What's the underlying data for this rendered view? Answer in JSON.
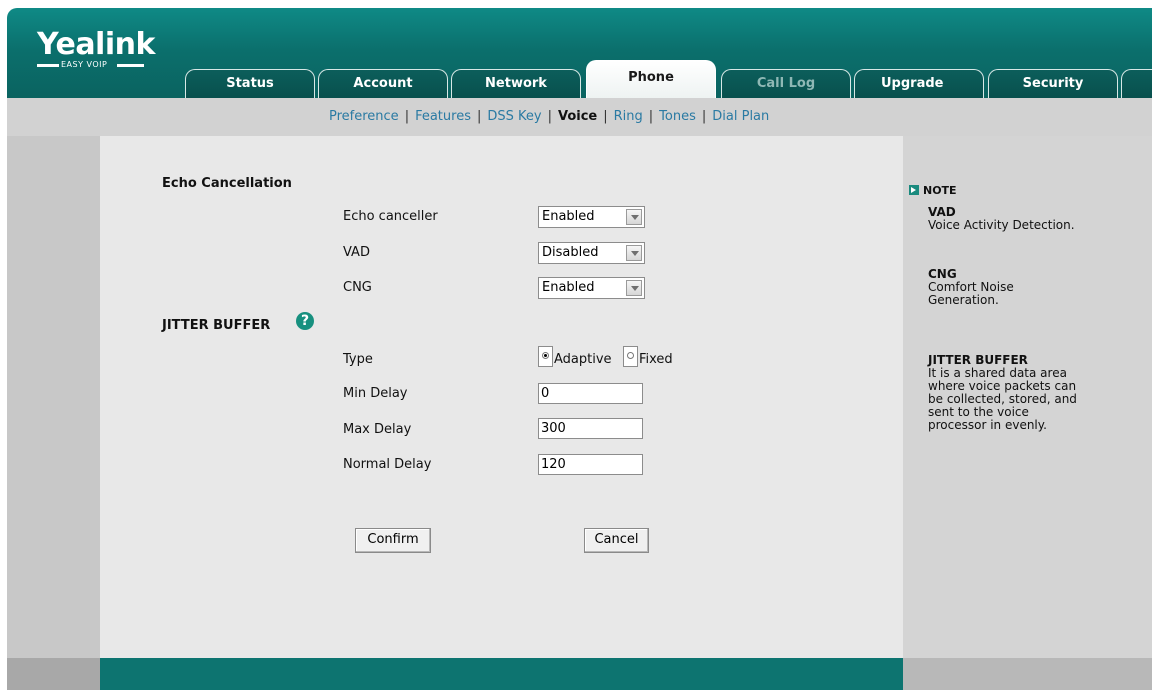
{
  "logo": {
    "main": "Yealink",
    "sub": "EASY VOIP"
  },
  "tabs": [
    {
      "label": "Status"
    },
    {
      "label": "Account"
    },
    {
      "label": "Network"
    },
    {
      "label": "Phone"
    },
    {
      "label": "Call Log"
    },
    {
      "label": "Upgrade"
    },
    {
      "label": "Security"
    }
  ],
  "active_tab": "Phone",
  "subnav": [
    {
      "label": "Preference"
    },
    {
      "label": "Features"
    },
    {
      "label": "DSS Key"
    },
    {
      "label": "Voice"
    },
    {
      "label": "Ring"
    },
    {
      "label": "Tones"
    },
    {
      "label": "Dial Plan"
    }
  ],
  "active_subnav": "Voice",
  "echo": {
    "title": "Echo Cancellation",
    "echo_canceller": {
      "label": "Echo canceller",
      "value": "Enabled"
    },
    "vad": {
      "label": "VAD",
      "value": "Disabled"
    },
    "cng": {
      "label": "CNG",
      "value": "Enabled"
    }
  },
  "jitter": {
    "title": "JITTER BUFFER",
    "help_icon": "?",
    "type": {
      "label": "Type",
      "options": [
        "Adaptive",
        "Fixed"
      ],
      "selected": "Adaptive"
    },
    "min_delay": {
      "label": "Min Delay",
      "value": "0"
    },
    "max_delay": {
      "label": "Max Delay",
      "value": "300"
    },
    "normal_delay": {
      "label": "Normal Delay",
      "value": "120"
    }
  },
  "buttons": {
    "confirm": "Confirm",
    "cancel": "Cancel"
  },
  "note": {
    "heading": "NOTE",
    "items": [
      {
        "title": "VAD",
        "lines": [
          "Voice Activity Detection."
        ]
      },
      {
        "title": "CNG",
        "lines": [
          "Comfort Noise",
          "Generation."
        ]
      },
      {
        "title": "JITTER BUFFER",
        "lines": [
          "It is a shared data area",
          "where voice packets can",
          "be collected, stored, and",
          "sent to the voice",
          "processor in evenly."
        ]
      }
    ]
  },
  "colors": {
    "header": "#0b6f6c",
    "footer": "#0d7470",
    "link": "#2a7aa3",
    "help_icon": "#17907f"
  }
}
